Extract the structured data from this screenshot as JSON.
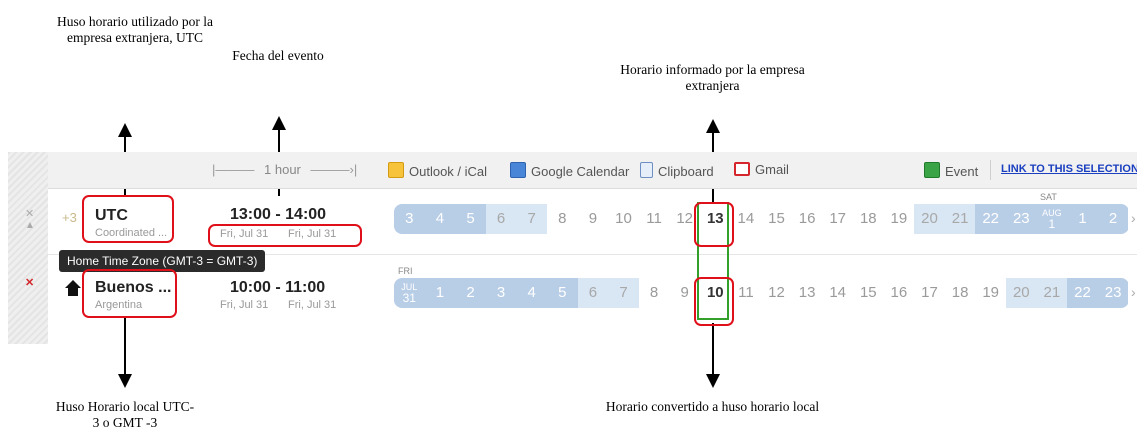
{
  "annotations": {
    "utc_zone_note": "Huso horario utilizado por la empresa extranjera, UTC",
    "event_date_note": "Fecha del evento",
    "reported_time_note": "Horario informado por la empresa extranjera",
    "local_zone_note": "Huso Horario local UTC-3 o GMT -3",
    "converted_time_note": "Horario convertido a huso horario local"
  },
  "toolbar": {
    "duration": "1 hour",
    "outlook": "Outlook / iCal",
    "google": "Google Calendar",
    "clipboard": "Clipboard",
    "gmail": "Gmail",
    "event": "Event",
    "link": "LINK TO THIS SELECTION"
  },
  "rows": [
    {
      "offset": "+3",
      "city": "UTC",
      "subtitle": "Coordinated ...",
      "time_range": "13:00 - 14:00",
      "date_start": "Fri, Jul 31",
      "date_end": "Fri, Jul 31",
      "day_marker": "SAT",
      "date_badge_top": "AUG",
      "date_badge_bottom": "1",
      "hours": [
        "3",
        "4",
        "5",
        "6",
        "7",
        "8",
        "9",
        "10",
        "11",
        "12",
        "13",
        "14",
        "15",
        "16",
        "17",
        "18",
        "19",
        "20",
        "21",
        "22",
        "23",
        "",
        "1",
        "2"
      ],
      "selected": "13"
    },
    {
      "city": "Buenos ...",
      "subtitle": "Argentina",
      "time_range": "10:00 - 11:00",
      "date_start": "Fri, Jul 31",
      "date_end": "Fri, Jul 31",
      "day_marker": "FRI",
      "date_badge_top": "JUL",
      "date_badge_bottom": "31",
      "tooltip": "Home Time Zone (GMT-3 = GMT-3)",
      "hours": [
        "",
        "1",
        "2",
        "3",
        "4",
        "5",
        "6",
        "7",
        "8",
        "9",
        "10",
        "11",
        "12",
        "13",
        "14",
        "15",
        "16",
        "17",
        "18",
        "19",
        "20",
        "21",
        "22",
        "23"
      ],
      "selected": "10"
    }
  ],
  "colors": {
    "night": "#b8cde6",
    "dawn": "#d9e6f4",
    "day": "#ffffff",
    "day_text": "#9a9a9a",
    "night_text": "#ffffff",
    "highlight": "#e0101a",
    "selection": "#33a02c"
  }
}
